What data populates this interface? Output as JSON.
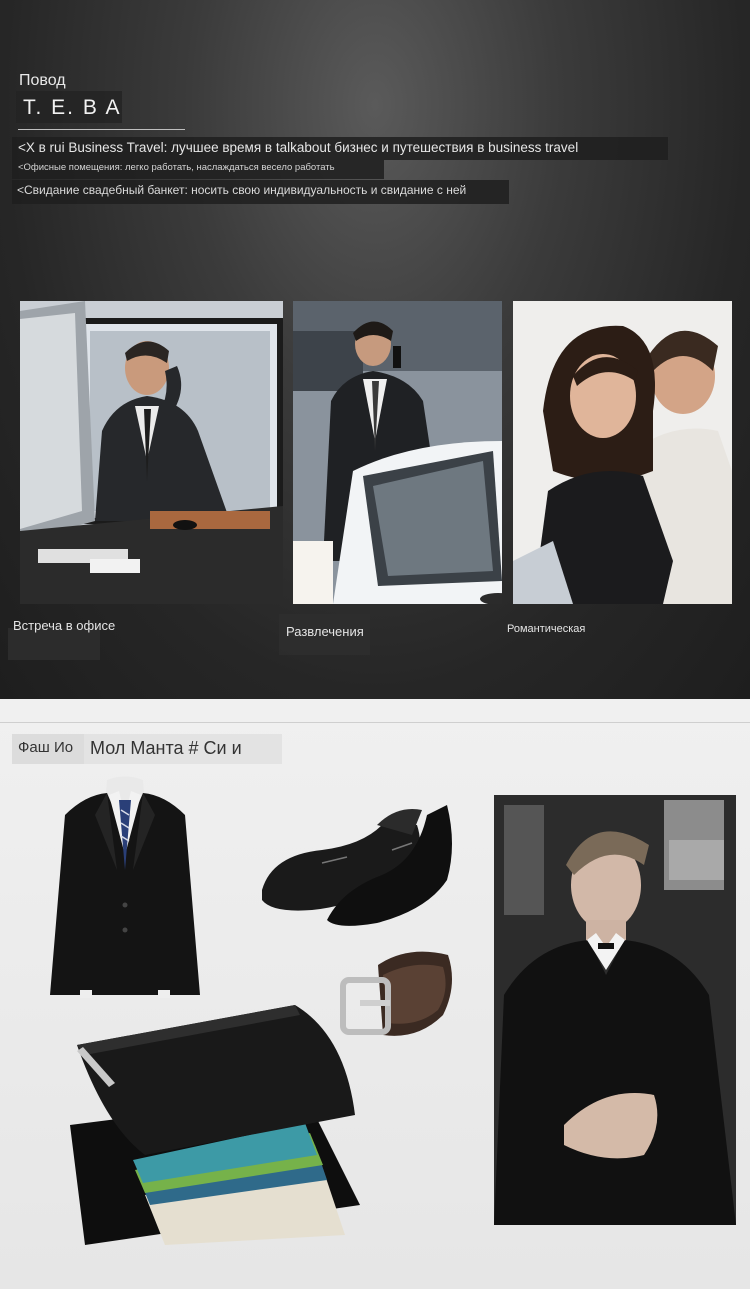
{
  "header": {
    "occasion_label": "Повод",
    "brand": "T. E. B A",
    "bullets": [
      "<X в rui Business Travel: лучшее время в talkabout бизнес и путешествия в business travel",
      "<Офисные помещения: легко работать, наслаждаться весело работать",
      "<Свидание свадебный банкет: носить свою индивидуальность и свидание с ней"
    ]
  },
  "scenes": [
    {
      "caption": "Встреча в офисе",
      "icon": "businessman-office-photo"
    },
    {
      "caption": "Развлечения",
      "icon": "businessman-car-phone-photo"
    },
    {
      "caption": "Романтическая",
      "icon": "couple-romantic-photo"
    }
  ],
  "fashion": {
    "tag_short": "Фаш Ио",
    "tag_long": "Мол Манта # Си и",
    "products": [
      "suit-jacket",
      "leather-shoes",
      "leather-belt",
      "leather-wallet",
      "model-in-suit"
    ]
  },
  "colors": {
    "dark_bg": "#262626",
    "light_bg": "#e9e9e9",
    "text_light": "#e6e6e6"
  }
}
